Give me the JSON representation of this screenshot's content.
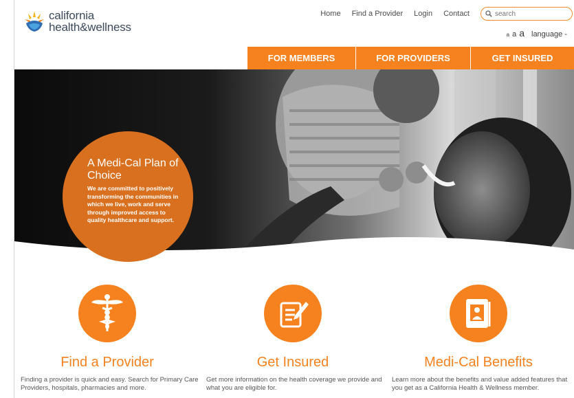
{
  "brand": {
    "line1": "california",
    "line2": "health&wellness",
    "mark": "california-health-and-wellness-logo-icon"
  },
  "topnav": {
    "links": [
      "Home",
      "Find a Provider",
      "Login",
      "Contact"
    ],
    "search_placeholder": "search"
  },
  "text_size": {
    "small": "a",
    "medium": "a",
    "large": "a"
  },
  "language_label": "language -",
  "mainnav": [
    "FOR MEMBERS",
    "FOR PROVIDERS",
    "GET INSURED"
  ],
  "hero": {
    "title": "A Medi-Cal Plan of Choice",
    "body": "We are committed to positively transforming the communities in which we live, work and serve through improved access to quality healthcare and support."
  },
  "features": [
    {
      "icon": "caduceus-icon",
      "title": "Find a Provider",
      "desc": "Finding a provider is quick and easy. Search for Primary Care Providers, hospitals, pharmacies and more."
    },
    {
      "icon": "notepad-pencil-icon",
      "title": "Get Insured",
      "desc": "Get more information on the health coverage we provide and what you are eligible for."
    },
    {
      "icon": "id-card-icon",
      "title": "Medi-Cal Benefits",
      "desc": "Learn more about the benefits and value added features that you get as a California Health & Wellness member."
    }
  ],
  "colors": {
    "accent": "#f5821f",
    "circle": "#d9701f",
    "brand_text": "#3d4a5c"
  }
}
